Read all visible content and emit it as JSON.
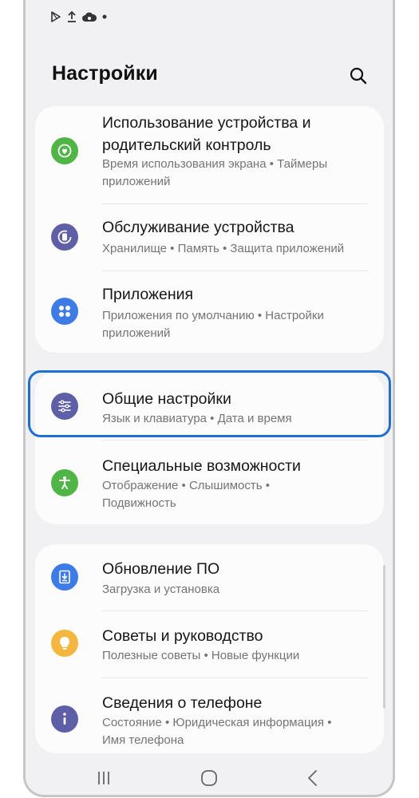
{
  "status_bar": {
    "icons": [
      "play-store-icon",
      "upload-icon",
      "cloud-sync-icon",
      "notification-dot-icon"
    ]
  },
  "header": {
    "title": "Настройки",
    "search_icon": "search-icon"
  },
  "cards": [
    {
      "items": [
        {
          "icon": "digital-wellbeing-icon",
          "icon_color": "#4fb545",
          "title_lines": [
            "Использование устройства и",
            "родительский контроль"
          ],
          "subtitle_lines": [
            "Время использования экрана  •  Таймеры",
            "приложений"
          ]
        },
        {
          "icon": "device-care-icon",
          "icon_color": "#5e5fa6",
          "title_lines": [
            "Обслуживание устройства"
          ],
          "subtitle_lines": [
            "Хранилище  •  Память  •  Защита приложений"
          ]
        },
        {
          "icon": "apps-icon",
          "icon_color": "#3c7be8",
          "title_lines": [
            "Приложения"
          ],
          "subtitle_lines": [
            "Приложения по умолчанию  •  Настройки",
            "приложений"
          ]
        }
      ]
    },
    {
      "items": [
        {
          "icon": "sliders-icon",
          "icon_color": "#5e5fa6",
          "title_lines": [
            "Общие настройки"
          ],
          "subtitle_lines": [
            "Язык и клавиатура  •  Дата и время"
          ],
          "highlighted": true
        },
        {
          "icon": "accessibility-icon",
          "icon_color": "#4fb545",
          "title_lines": [
            "Специальные возможности"
          ],
          "subtitle_lines": [
            "Отображение  •  Слышимость  •",
            "Подвижность"
          ]
        }
      ]
    },
    {
      "items": [
        {
          "icon": "software-update-icon",
          "icon_color": "#3c7be8",
          "title_lines": [
            "Обновление ПО"
          ],
          "subtitle_lines": [
            "Загрузка и установка"
          ]
        },
        {
          "icon": "lightbulb-icon",
          "icon_color": "#f4b63c",
          "title_lines": [
            "Советы и руководство"
          ],
          "subtitle_lines": [
            "Полезные советы  •  Новые функции"
          ]
        },
        {
          "icon": "info-icon",
          "icon_color": "#5e5fa6",
          "title_lines": [
            "Сведения о телефоне"
          ],
          "subtitle_lines": [
            "Состояние  •  Юридическая информация  •",
            "Имя телефона"
          ]
        }
      ]
    }
  ],
  "nav_bar": {
    "buttons": [
      "recent-apps-icon",
      "home-icon",
      "back-icon"
    ]
  },
  "colors": {
    "background": "#f1f1f3",
    "card": "#fcfcfc",
    "highlight": "#1d6fd8"
  }
}
